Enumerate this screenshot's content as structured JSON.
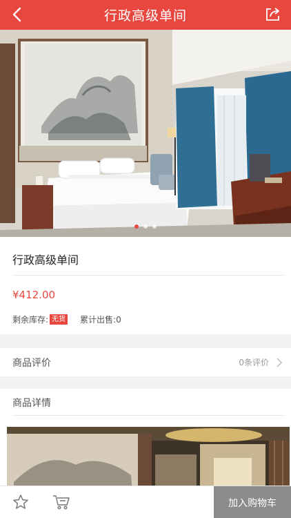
{
  "header": {
    "title": "行政高级单间",
    "back_icon": "chevron-left-icon",
    "share_icon": "share-icon",
    "background": "#e8473f"
  },
  "carousel": {
    "slides": 3,
    "active_index": 0
  },
  "product": {
    "name": "行政高级单间",
    "price": "¥412.00",
    "stock_label": "剩余库存:",
    "stock_value": "无货",
    "sold_label": "累计出售:",
    "sold_value": "0"
  },
  "reviews": {
    "label": "商品评价",
    "count": "0条评价",
    "chevron_icon": "chevron-right-icon"
  },
  "details": {
    "label": "商品详情"
  },
  "bottom_bar": {
    "favorite_icon": "star-icon",
    "cart_icon": "cart-icon",
    "add_to_cart": "加入购物车",
    "add_to_cart_color": "#8b8b8b"
  },
  "colors": {
    "accent": "#e8473f",
    "price": "#e8473f",
    "page_bg": "#f2f2f2"
  }
}
